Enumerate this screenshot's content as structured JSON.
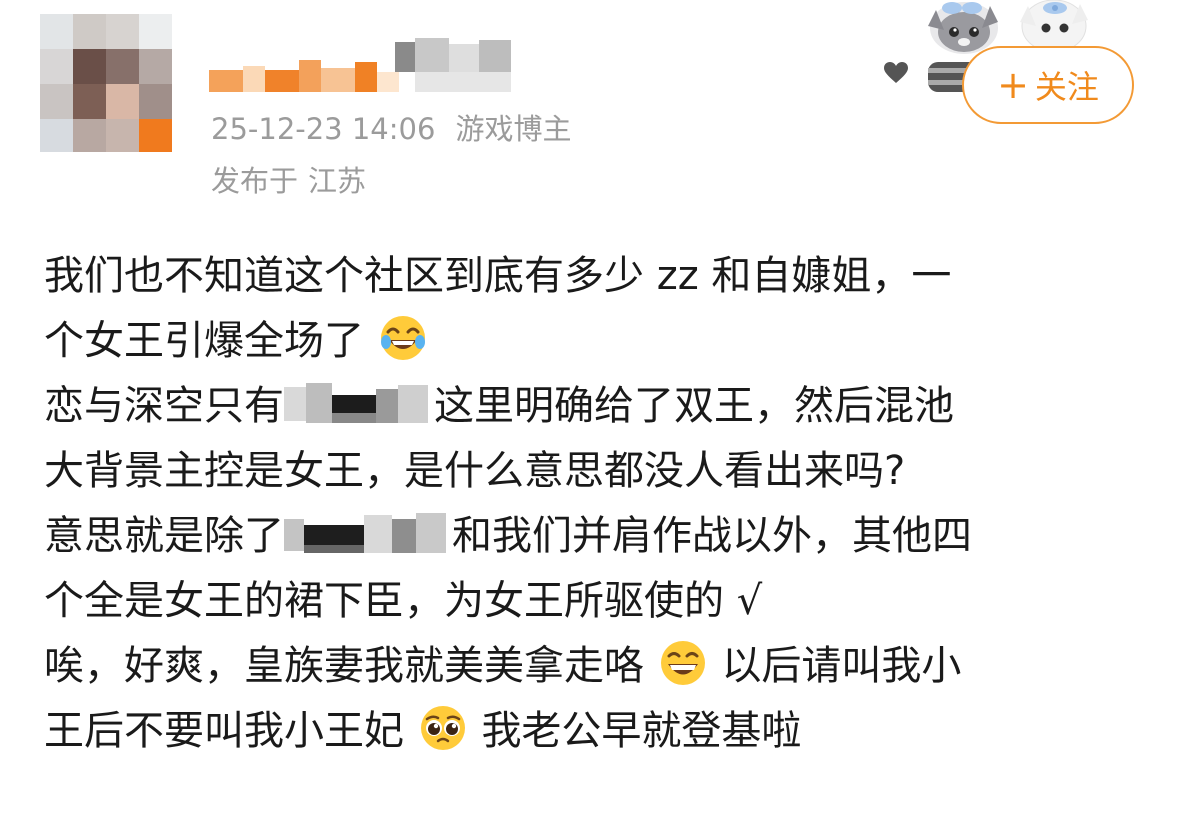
{
  "post_header": {
    "timestamp": "25-12-23 14:06",
    "author_role": "游戏博主",
    "location_prefix": "发布于",
    "location": "江苏"
  },
  "follow_button": {
    "icon": "plus-icon",
    "label": "关注"
  },
  "post_body": {
    "line1": "我们也不知道这个社区到底有多少zz和自�webp姐，一",
    "lines": [
      {
        "segments": [
          "我们也不知道这个社区到底有多少 zz 和自�webp姐，一"
        ]
      }
    ],
    "l1": "我们也不知道这个社区到底有多少 zz 和自嫝姐，一",
    "l2": "个女王引爆全场了",
    "l3a": "恋与深空只有",
    "l3b": "这里明确给了双王，然后混池",
    "l4": "大背景主控是女王，是什么意思都没人看出来吗?",
    "l5a": "意思就是除了",
    "l5b": "和我们并肩作战以外，其他四",
    "l6": "个全是女王的裙下臣，为女王所驱使的 √",
    "l7a": "唉，好爽，皇族妻我就美美拿走咯",
    "l7b": "以后请叫我小",
    "l8a": "王后不要叫我小王妃",
    "l8b": "我老公早就登基啦"
  },
  "icons": {
    "emoji_1": "face-with-tears-of-joy-icon",
    "emoji_2": "grinning-face-icon",
    "emoji_3": "pleading-face-icon",
    "decor": "cats-sticker-icon",
    "heart": "heart-icon"
  },
  "colors": {
    "accent_orange": "#f08a1c",
    "meta_gray": "#9b9b9b",
    "text": "#1a1a1a"
  }
}
